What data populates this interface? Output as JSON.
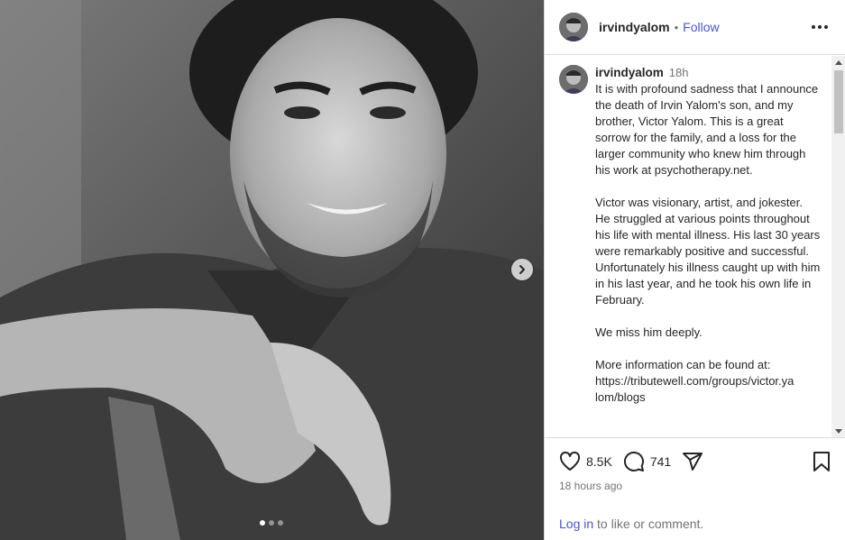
{
  "post": {
    "username": "irvindyalom",
    "separator": "•",
    "follow_label": "Follow",
    "more_icon": "more-horizontal-icon"
  },
  "media": {
    "description_icon": "photo",
    "carousel": {
      "current": 1,
      "total": 3
    }
  },
  "caption": {
    "username": "irvindyalom",
    "time": "18h",
    "paragraphs": [
      "It is with profound sadness that I announce the death of Irvin Yalom's son, and my brother, Victor Yalom. This is a great sorrow for the family, and a loss for the  larger community who knew him through his work at psychotherapy.net.",
      "Victor was visionary, artist, and jokester. He struggled at various points throughout his life with mental illness. His last 30 years were remarkably positive and successful. Unfortunately his illness caught up with him in his last year, and he took his own life in February.",
      "We miss him deeply.",
      "More information can be found at:\nhttps://tributewell.com/groups/victor.ya\nlom/blogs"
    ]
  },
  "actions": {
    "likes": "8.5K",
    "comments": "741"
  },
  "timestamp": "18 hours ago",
  "login": {
    "link": "Log in",
    "rest": " to like or comment."
  }
}
